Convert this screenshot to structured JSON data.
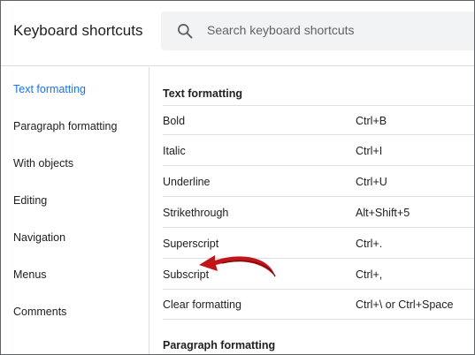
{
  "header": {
    "title": "Keyboard shortcuts",
    "search_placeholder": "Search keyboard shortcuts",
    "search_icon": "search-icon"
  },
  "sidebar": {
    "items": [
      {
        "label": "Text formatting",
        "active": true
      },
      {
        "label": "Paragraph formatting",
        "active": false
      },
      {
        "label": "With objects",
        "active": false
      },
      {
        "label": "Editing",
        "active": false
      },
      {
        "label": "Navigation",
        "active": false
      },
      {
        "label": "Menus",
        "active": false
      },
      {
        "label": "Comments",
        "active": false
      }
    ]
  },
  "main": {
    "sections": [
      {
        "title": "Text formatting",
        "shortcuts": [
          {
            "name": "Bold",
            "keys": "Ctrl+B"
          },
          {
            "name": "Italic",
            "keys": "Ctrl+I"
          },
          {
            "name": "Underline",
            "keys": "Ctrl+U"
          },
          {
            "name": "Strikethrough",
            "keys": "Alt+Shift+5"
          },
          {
            "name": "Superscript",
            "keys": "Ctrl+."
          },
          {
            "name": "Subscript",
            "keys": "Ctrl+,"
          },
          {
            "name": "Clear formatting",
            "keys": "Ctrl+\\ or Ctrl+Space"
          }
        ]
      },
      {
        "title": "Paragraph formatting",
        "shortcuts": []
      }
    ]
  },
  "colors": {
    "accent": "#1a73e8",
    "annotation_arrow": "#c0161a",
    "search_bg": "#f1f3f4",
    "divider": "#dadce0"
  }
}
